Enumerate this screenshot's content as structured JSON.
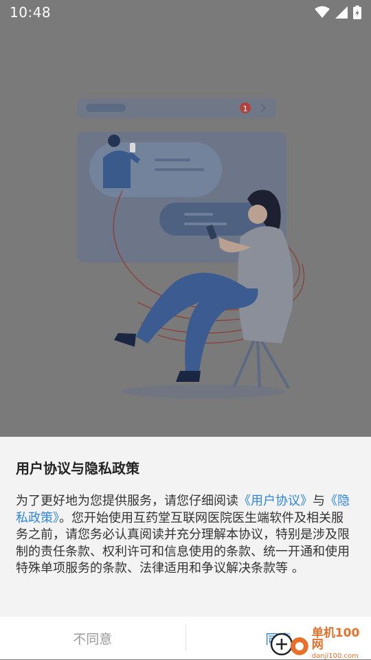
{
  "status_bar": {
    "time": "10:48"
  },
  "dialog": {
    "title": "用户协议与隐私政策",
    "body_part1": "为了更好地为您提供服务，请您仔细阅读",
    "link_user_agreement": "《用户协议》",
    "body_part2": "与",
    "link_privacy_policy": "《隐私政策》",
    "body_part3": "。您开始使用互药堂互联网医院医生端软件及相关服务之前，请您务必认真阅读并充分理解本协议，特别是涉及限制的责任条款、权利许可和信息使用的条款、统一开通和使用特殊单项服务的条款、法律适用和争议解决条款等 。"
  },
  "buttons": {
    "disagree": "不同意",
    "agree": "同意"
  },
  "watermark": {
    "main": "单机100网",
    "sub": "danji100.com"
  },
  "illustration": {
    "badge": "1"
  },
  "colors": {
    "accent": "#2f86e0",
    "overlay": "#7a7a7a",
    "dialog_bg": "#f3f3f3"
  }
}
